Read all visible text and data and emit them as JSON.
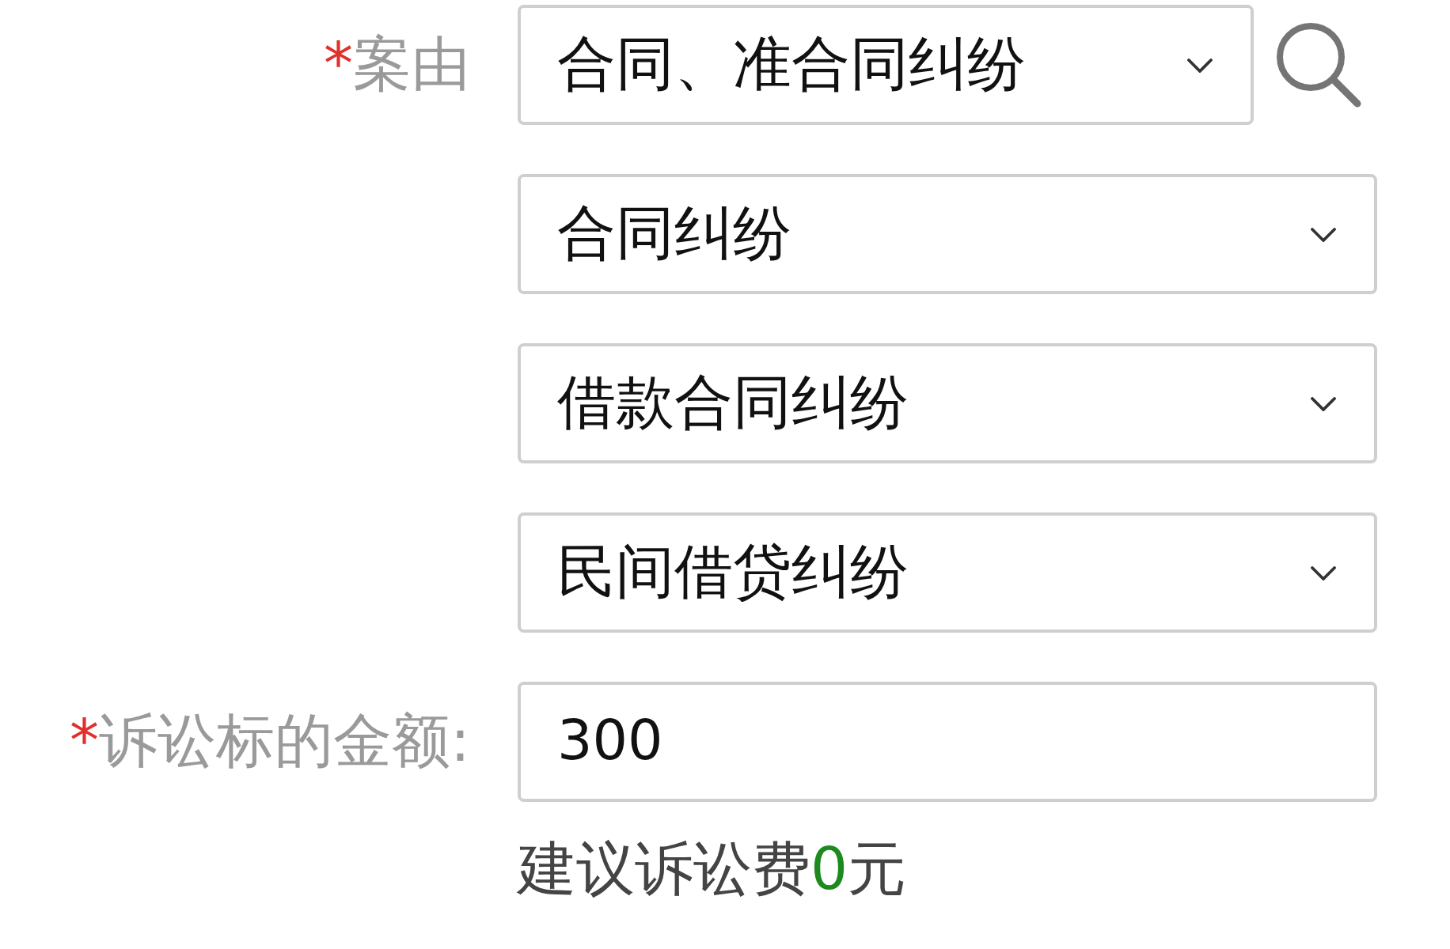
{
  "rows": [
    {
      "kind": "select",
      "label": {
        "required_mark": "*",
        "text": "案由"
      },
      "value": "合同、准合同纠纷",
      "search": true
    },
    {
      "kind": "select",
      "value": "合同纠纷"
    },
    {
      "kind": "select",
      "value": "借款合同纠纷"
    },
    {
      "kind": "select",
      "value": "民间借贷纠纷"
    },
    {
      "kind": "input",
      "label": {
        "required_mark": "*",
        "text": "诉讼标的金额:"
      },
      "value": "300"
    }
  ],
  "fee_note": {
    "text": "建议诉讼费",
    "amount": "0",
    "unit": "元"
  }
}
